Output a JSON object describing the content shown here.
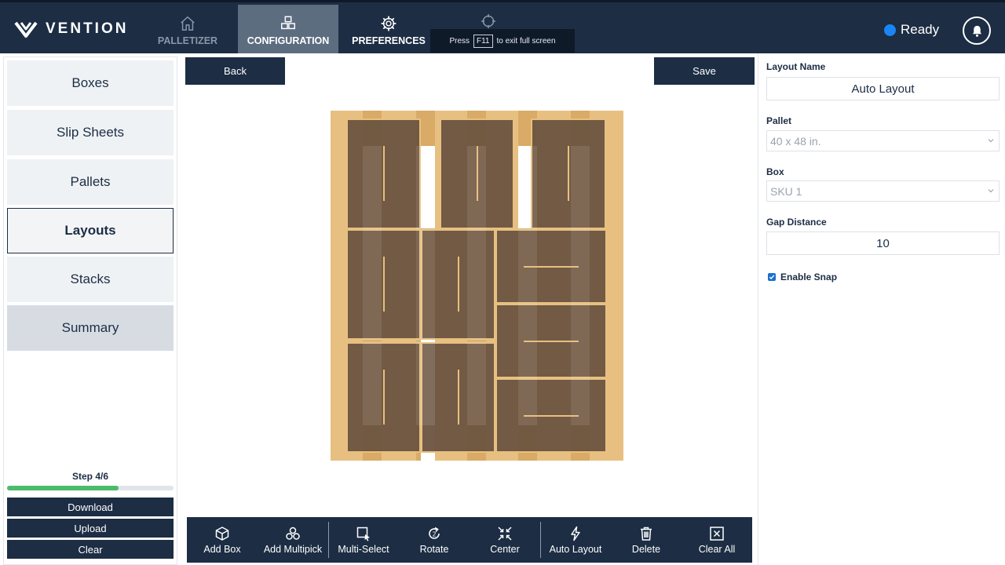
{
  "app": {
    "brand": "VENTION",
    "tabs": [
      {
        "label": "PALLETIZER",
        "icon": "home-icon"
      },
      {
        "label": "CONFIGURATION",
        "icon": "boxes-icon"
      },
      {
        "label": "PREFERENCES",
        "icon": "gear-icon"
      }
    ],
    "fullscreen_toast": {
      "prefix": "Press",
      "key": "F11",
      "suffix": "to exit full screen"
    },
    "status": "Ready"
  },
  "sidebar": {
    "items": [
      {
        "label": "Boxes"
      },
      {
        "label": "Slip Sheets"
      },
      {
        "label": "Pallets"
      },
      {
        "label": "Layouts",
        "active": true
      },
      {
        "label": "Stacks"
      },
      {
        "label": "Summary"
      }
    ],
    "step_label": "Step 4/6",
    "progress": 0.67,
    "buttons": {
      "download": "Download",
      "upload": "Upload",
      "clear": "Clear"
    }
  },
  "main": {
    "back_label": "Back",
    "save_label": "Save",
    "colors": {
      "pallet": "#e7c081",
      "box": "#6b5440",
      "box_border": "#e7c081"
    },
    "toolbar": [
      {
        "label": "Add Box",
        "icon": "cube-icon"
      },
      {
        "label": "Add Multipick",
        "icon": "multipick-icon"
      },
      {
        "label": "Multi-Select",
        "icon": "select-icon"
      },
      {
        "label": "Rotate",
        "icon": "rotate-icon"
      },
      {
        "label": "Center",
        "icon": "center-icon"
      },
      {
        "label": "Auto Layout",
        "icon": "bolt-icon"
      },
      {
        "label": "Delete",
        "icon": "trash-icon"
      },
      {
        "label": "Clear All",
        "icon": "clear-all-icon"
      }
    ]
  },
  "panel": {
    "layout_name_label": "Layout Name",
    "layout_name_value": "Auto Layout",
    "pallet_label": "Pallet",
    "pallet_value": "40 x 48 in.",
    "box_label": "Box",
    "box_value": "SKU 1",
    "gap_label": "Gap Distance",
    "gap_value": "10",
    "snap_label": "Enable Snap",
    "snap_checked": true
  }
}
